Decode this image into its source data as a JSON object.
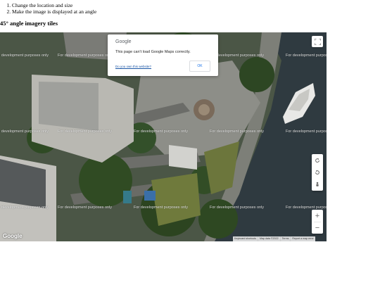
{
  "steps": [
    "Change the location and size",
    "Make the image is displayed at an angle"
  ],
  "section_title": "45° angle imagery tiles",
  "map": {
    "watermark": "For development purposes only",
    "google_logo": "Google",
    "dialog": {
      "logo": "Google",
      "message": "This page can't load Google Maps correctly.",
      "own_link": "Do you own this website?",
      "ok_label": "OK"
    },
    "controls": {
      "fullscreen_icon": "fullscreen-icon",
      "rotate_cw_icon": "rotate-clockwise-icon",
      "rotate_ccw_icon": "rotate-counterclockwise-icon",
      "pegman_icon": "street-view-pegman-icon",
      "zoom_in": "+",
      "zoom_out": "−"
    },
    "attribution": {
      "shortcuts": "Keyboard shortcuts",
      "map_data": "Map data ©2022",
      "terms": "Terms",
      "report": "Report a map error"
    }
  },
  "colors": {
    "water": "#2f3a40",
    "plaza": "#8d8e88",
    "trees": "#2f4a22",
    "grass": "#6f7a3c",
    "link": "#1a55a5",
    "ok_text": "#1a73e8"
  }
}
